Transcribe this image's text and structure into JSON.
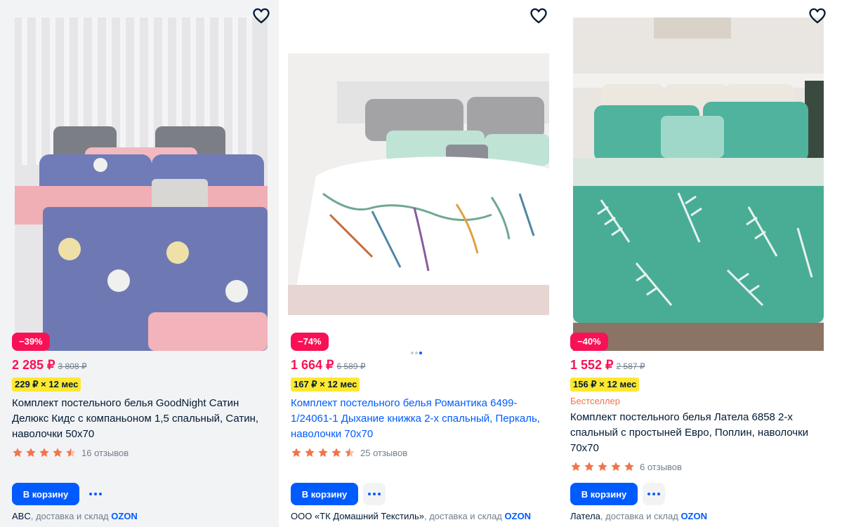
{
  "accent": "#005bff",
  "sale_color": "#f91155",
  "products": [
    {
      "discount": "−39%",
      "price": "2 285 ₽",
      "old_price": "3 808 ₽",
      "installment": "229 ₽ × 12 мес",
      "title": "Комплект постельного белья GoodNight Сатин Делюкс Кидс с компаньоном 1,5 спальный, Сатин, наволочки 50х70",
      "rating": 4.5,
      "reviews": "16 отзывов",
      "cart_label": "В корзину",
      "seller_name": "ABC",
      "seller_delivery": ", доставка и склад ",
      "seller_ozon": "OZON",
      "fav_icon": "heart-outline-icon"
    },
    {
      "discount": "−74%",
      "price": "1 664 ₽",
      "old_price": "6 589 ₽",
      "installment": "167 ₽ × 12 мес",
      "title": "Комплект постельного белья Романтика 6499-1/24061-1 Дыхание книжка 2-х спальный, Перкаль, наволочки 70х70",
      "rating": 4.5,
      "reviews": "25 отзывов",
      "cart_label": "В корзину",
      "seller_name": "ООО «ТК Домашний Текстиль»",
      "seller_delivery": ", доставка и склад ",
      "seller_ozon": "OZON",
      "fav_icon": "heart-outline-icon"
    },
    {
      "discount": "−40%",
      "price": "1 552 ₽",
      "old_price": "2 587 ₽",
      "installment": "156 ₽ × 12 мес",
      "bestseller": "Бестселлер",
      "title": "Комплект постельного белья Латела 6858 2-х спальный с простыней Евро, Поплин, наволочки 70х70",
      "rating": 5,
      "reviews": "6 отзывов",
      "cart_label": "В корзину",
      "seller_name": "Латела",
      "seller_delivery": ", доставка и склад ",
      "seller_ozon": "OZON",
      "fav_icon": "heart-outline-icon"
    }
  ]
}
